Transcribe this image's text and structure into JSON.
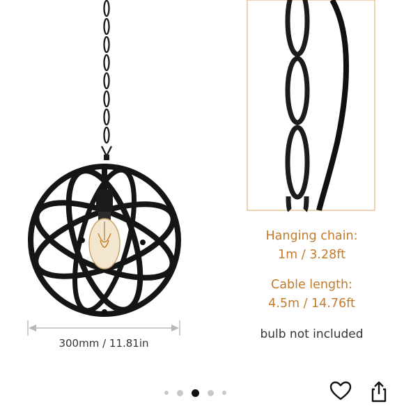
{
  "product": {
    "specs": {
      "hanging_chain_label": "Hanging chain:",
      "hanging_chain_value": "1m / 3.28ft",
      "cable_length_label": "Cable length:",
      "cable_length_value": "4.5m / 14.76ft",
      "bulb_note": "bulb not included"
    },
    "dimension_label": "300mm / 11.81in"
  },
  "colors": {
    "spec_accent": "#c27a2c",
    "frame_border": "#e8b98a",
    "dot_inactive": "#c8c8c8",
    "dot_active": "#111111"
  },
  "pagination": {
    "total": 5,
    "active_index": 2
  },
  "actions": {
    "wishlist_icon": "heart-icon",
    "share_icon": "share-icon"
  }
}
